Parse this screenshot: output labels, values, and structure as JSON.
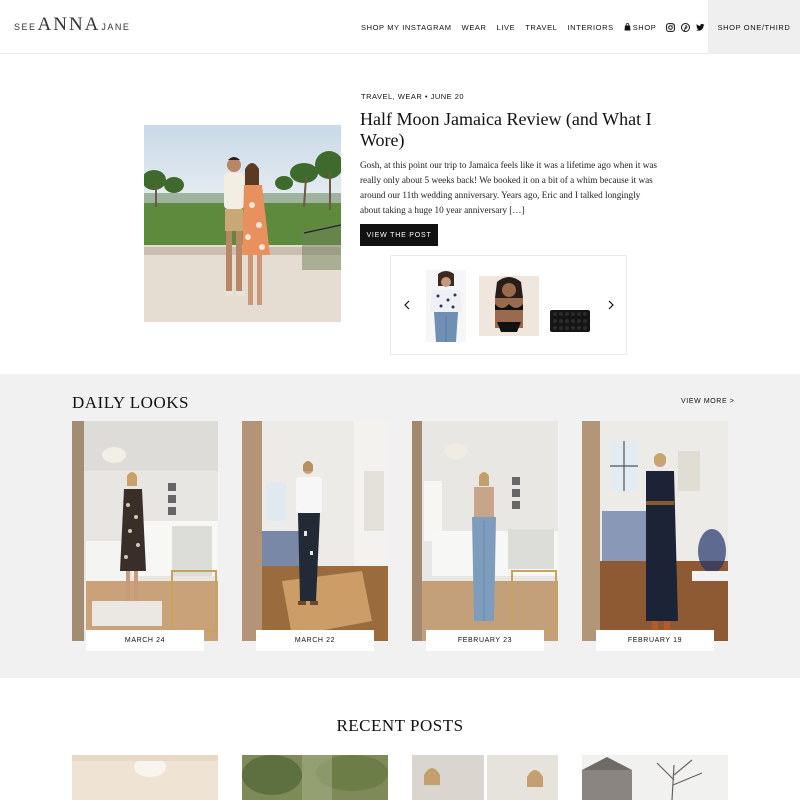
{
  "header": {
    "logo": {
      "see": "SEE",
      "anna": "ANNA",
      "jane": "JANE"
    },
    "nav": [
      {
        "label": "SHOP MY INSTAGRAM"
      },
      {
        "label": "WEAR"
      },
      {
        "label": "LIVE"
      },
      {
        "label": "TRAVEL"
      },
      {
        "label": "INTERIORS"
      },
      {
        "label": "SHOP"
      }
    ],
    "social_icons": [
      "instagram-icon",
      "pinterest-icon",
      "twitter-icon",
      "heart-icon",
      "search-icon"
    ],
    "shop_button": "SHOP ONE/THIRD"
  },
  "featured": {
    "meta": "TRAVEL, WEAR • JUNE 20",
    "title": "Half Moon Jamaica Review (and What I Wore)",
    "excerpt": "Gosh, at this point our trip to Jamaica feels like it was a lifetime ago when it was really only about 5 weeks back!  We booked it on a bit of a whim because it was around our 11th wedding anniversary.  Years ago, Eric and I talked longingly about taking a huge 10 year anniversary […]",
    "button": "VIEW THE POST",
    "carousel_icons": [
      "chevron-left-icon",
      "chevron-right-icon"
    ]
  },
  "daily_looks": {
    "title": "DAILY LOOKS",
    "view_more": "VIEW MORE >",
    "items": [
      {
        "date": "MARCH 24"
      },
      {
        "date": "MARCH 22"
      },
      {
        "date": "FEBRUARY 23"
      },
      {
        "date": "FEBRUARY 19"
      }
    ]
  },
  "recent_posts": {
    "title": "RECENT POSTS"
  },
  "colors": {
    "accent": "#111111",
    "band": "#f1f1f1",
    "shop_bg": "#efefef"
  }
}
